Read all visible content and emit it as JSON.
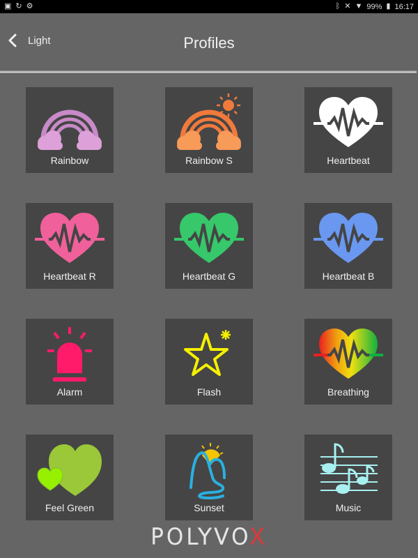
{
  "status_bar": {
    "left_icons": [
      "gallery-icon",
      "sync-icon",
      "settings-icon"
    ],
    "right_icons": [
      "bluetooth-icon",
      "mute-icon",
      "wifi-icon"
    ],
    "battery": "99%",
    "time": "16:17"
  },
  "header": {
    "back_label": "Light",
    "title": "Profiles"
  },
  "profiles": [
    {
      "label": "Rainbow",
      "icon": "rainbow-icon",
      "color": "#c88ac8"
    },
    {
      "label": "Rainbow S",
      "icon": "rainbow-sun-icon",
      "color": "#f07a3c"
    },
    {
      "label": "Heartbeat",
      "icon": "heartbeat-icon",
      "color": "#ffffff"
    },
    {
      "label": "Heartbeat R",
      "icon": "heartbeat-icon",
      "color": "#f0609a"
    },
    {
      "label": "Heartbeat G",
      "icon": "heartbeat-icon",
      "color": "#36c86a"
    },
    {
      "label": "Heartbeat B",
      "icon": "heartbeat-icon",
      "color": "#6a98f0"
    },
    {
      "label": "Alarm",
      "icon": "alarm-light-icon",
      "color": "#ff1a6a"
    },
    {
      "label": "Flash",
      "icon": "star-flash-icon",
      "color": "#f5f000"
    },
    {
      "label": "Breathing",
      "icon": "heartbeat-gradient-icon",
      "color": "#f0a020"
    },
    {
      "label": "Feel Green",
      "icon": "hearts-icon",
      "color": "#9ac838"
    },
    {
      "label": "Sunset",
      "icon": "sunset-mountain-icon",
      "color": "#2ab0e0"
    },
    {
      "label": "Music",
      "icon": "music-notes-icon",
      "color": "#a8f0f0"
    }
  ],
  "logo": {
    "main": "POLYVO",
    "accent": "X",
    "accent_color": "#d83a3a"
  }
}
